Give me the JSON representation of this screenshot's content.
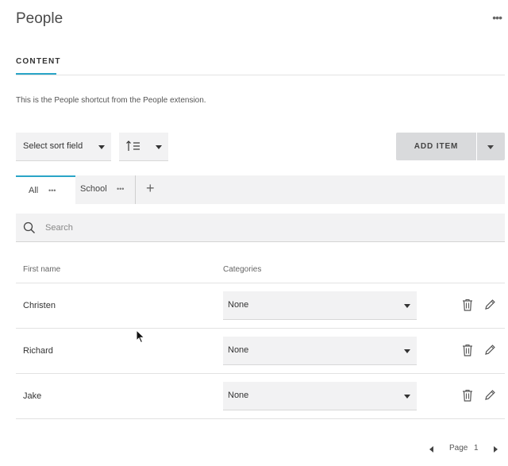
{
  "page": {
    "title": "People",
    "more_label": "•••"
  },
  "tabs": {
    "content_label": "CONTENT"
  },
  "description": "This is the People shortcut from the People extension.",
  "toolbar": {
    "sort_field_label": "Select sort field",
    "add_item_label": "ADD ITEM"
  },
  "views": {
    "items": [
      {
        "label": "All",
        "dots": "•••"
      },
      {
        "label": "School",
        "dots": "•••"
      }
    ],
    "add_label": "+"
  },
  "search": {
    "placeholder": "Search",
    "value": ""
  },
  "table": {
    "columns": [
      "First name",
      "Categories"
    ],
    "rows": [
      {
        "first_name": "Christen",
        "category": "None"
      },
      {
        "first_name": "Richard",
        "category": "None"
      },
      {
        "first_name": "Jake",
        "category": "None"
      }
    ]
  },
  "pagination": {
    "page_label": "Page",
    "current_page": "1"
  },
  "colors": {
    "accent": "#2aa5c7",
    "field_bg": "#f2f2f3",
    "button_bg": "#d9dadc"
  }
}
